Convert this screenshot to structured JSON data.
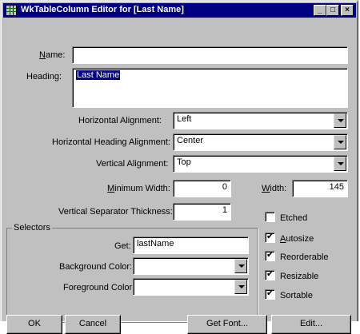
{
  "window": {
    "title": "WkTableColumn Editor for [Last Name]",
    "controls": {
      "minimize": "_",
      "maximize": "□",
      "close": "×"
    }
  },
  "form": {
    "name_label_u": "N",
    "name_label_rest": "ame:",
    "name_value": "",
    "heading_label": "Heading:",
    "heading_value": "Last Name",
    "halign_label": "Horizontal Alignment:",
    "halign_value": "Left",
    "hhalign_label": "Horizontal Heading Alignment:",
    "hhalign_value": "Center",
    "valign_label": "Vertical Alignment:",
    "valign_value": "Top",
    "minwidth_label_u": "M",
    "minwidth_label_rest": "inimum Width:",
    "minwidth_value": "0",
    "width_label_u": "W",
    "width_label_rest": "idth:",
    "width_value": "145",
    "vsep_label": "Vertical Separator Thickness:",
    "vsep_value": "1"
  },
  "selectors": {
    "group_label": "Selectors",
    "get_label": "Get:",
    "get_value": "lastName",
    "bg_label": "Background Color:",
    "bg_value": "",
    "fg_label": "Foreground Color:",
    "fg_value": ""
  },
  "options": {
    "etched": {
      "label": "Etched",
      "checked": false
    },
    "autosize": {
      "label_u": "A",
      "label_rest": "utosize",
      "checked": true
    },
    "reorderable": {
      "label": "Reorderable",
      "checked": true
    },
    "resizable": {
      "label": "Resizable",
      "checked": true
    },
    "sortable": {
      "label": "Sortable",
      "checked": true
    }
  },
  "buttons": {
    "ok": "OK",
    "cancel": "Cancel",
    "get_font": "Get Font",
    "get_font_dots": "...",
    "edit": "Edit..."
  }
}
